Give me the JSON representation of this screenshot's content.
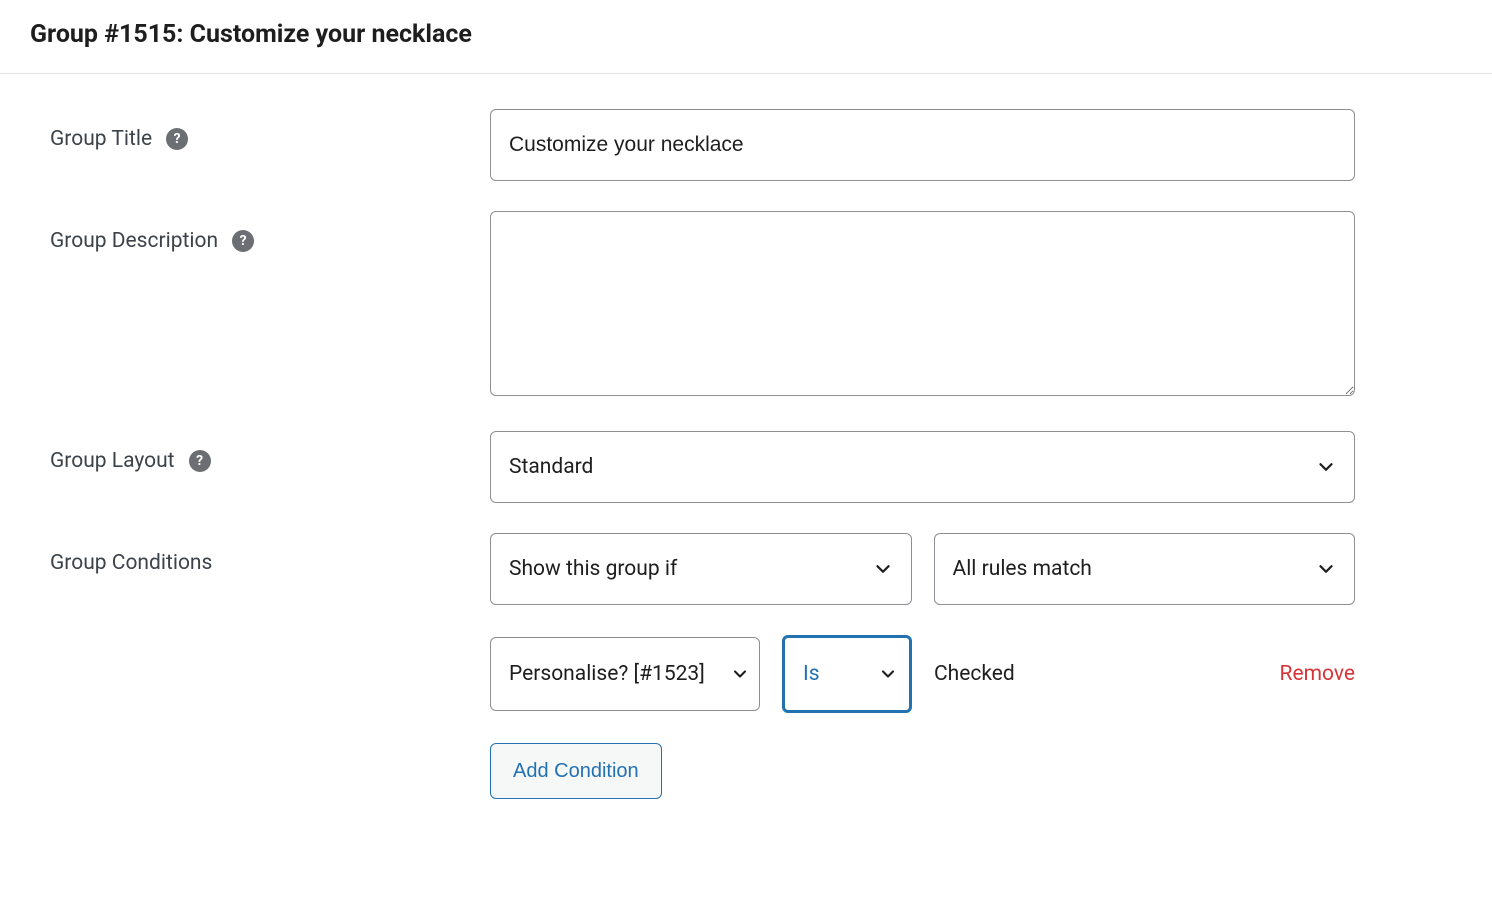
{
  "header": {
    "title": "Group #1515: Customize your necklace"
  },
  "labels": {
    "group_title": "Group Title",
    "group_description": "Group Description",
    "group_layout": "Group Layout",
    "group_conditions": "Group Conditions"
  },
  "values": {
    "group_title": "Customize your necklace",
    "group_description": "",
    "group_layout": "Standard"
  },
  "conditions": {
    "action_selected": "Show this group if",
    "match_selected": "All rules match",
    "rules": [
      {
        "field": "Personalise? [#1523]",
        "operator": "Is",
        "value": "Checked",
        "remove_label": "Remove"
      }
    ],
    "add_button_label": "Add Condition"
  }
}
